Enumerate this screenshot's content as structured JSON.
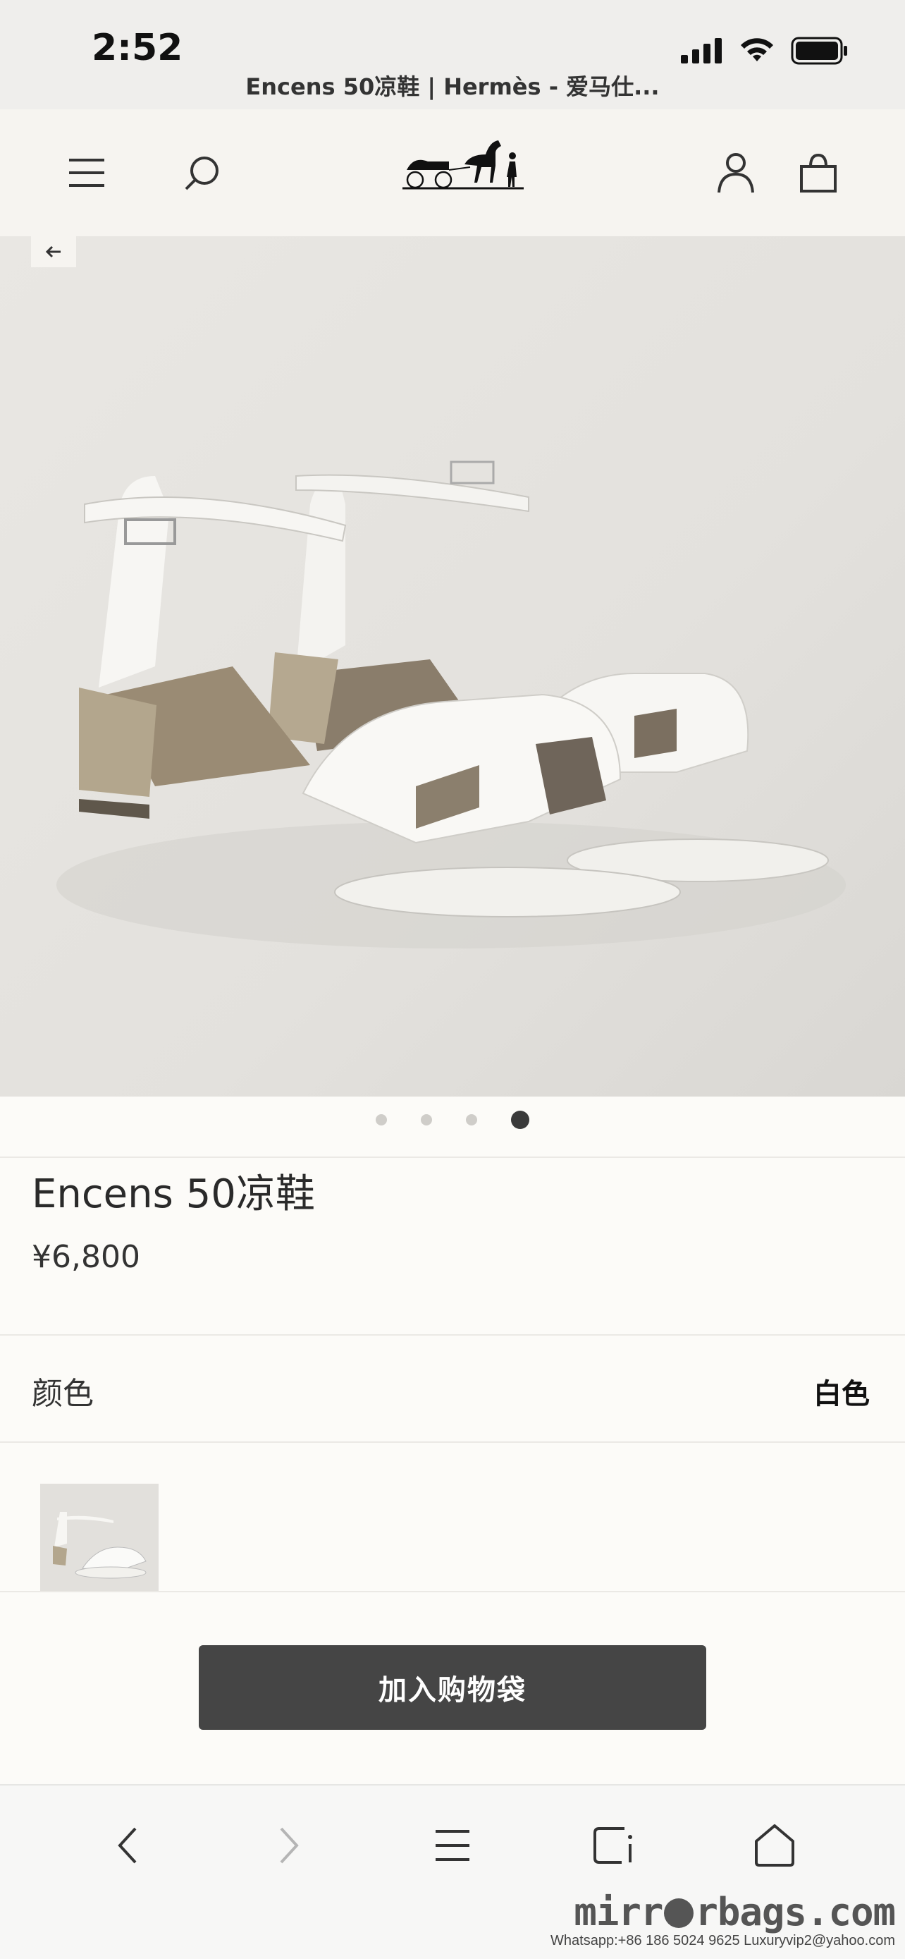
{
  "status_bar": {
    "time": "2:52",
    "page_title": "Encens 50凉鞋 | Hermès - 爱马仕..."
  },
  "header": {
    "menu_icon": "menu-icon",
    "search_icon": "search-icon",
    "logo": "hermes-carriage-logo",
    "account_icon": "account-icon",
    "bag_icon": "shopping-bag-icon"
  },
  "gallery": {
    "back_icon": "arrow-left-icon",
    "dot_count": 4,
    "active_index": 3
  },
  "product": {
    "name": "Encens 50凉鞋",
    "price": "¥6,800"
  },
  "color_section": {
    "label": "颜色",
    "value": "白色"
  },
  "actions": {
    "add_to_bag": "加入购物袋"
  },
  "browser_toolbar": {
    "buttons": [
      "back-icon",
      "forward-icon",
      "menu-icon",
      "tabs-icon",
      "home-icon"
    ]
  },
  "watermark": {
    "brand": "mirr",
    "brand_rest": "rbags.com",
    "contact": "Whatsapp:+86 186 5024 9625   Luxuryvip2@yahoo.com"
  },
  "colors": {
    "page_bg": "#fcfbf8",
    "header_bg": "#f6f4f0",
    "button_bg": "#454545"
  }
}
